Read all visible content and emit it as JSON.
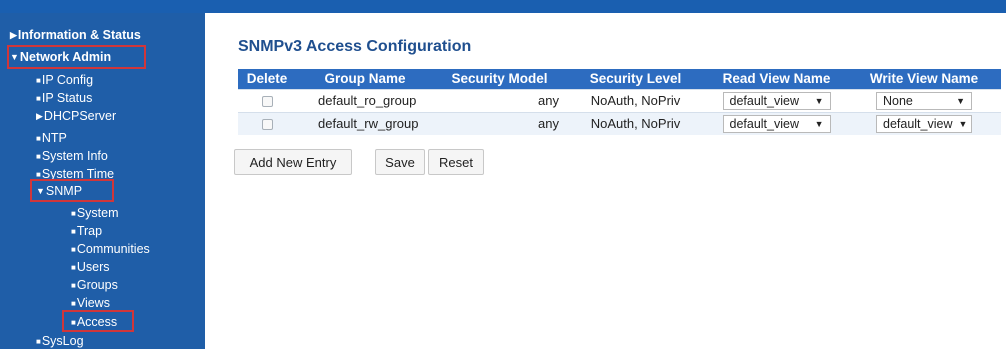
{
  "sidebar": {
    "items": [
      {
        "label": "Information & Status"
      },
      {
        "label": "Network Admin"
      },
      {
        "label": "IP Config"
      },
      {
        "label": "IP Status"
      },
      {
        "label": "DHCPServer"
      },
      {
        "label": "NTP"
      },
      {
        "label": "System Info"
      },
      {
        "label": "System Time"
      },
      {
        "label": "SNMP"
      },
      {
        "label": "System"
      },
      {
        "label": "Trap"
      },
      {
        "label": "Communities"
      },
      {
        "label": "Users"
      },
      {
        "label": "Groups"
      },
      {
        "label": "Views"
      },
      {
        "label": "Access"
      },
      {
        "label": "SysLog"
      }
    ]
  },
  "main": {
    "title": "SNMPv3 Access Configuration",
    "table": {
      "headers": [
        "Delete",
        "Group Name",
        "Security Model",
        "Security Level",
        "Read View Name",
        "Write View Name"
      ],
      "rows": [
        {
          "group": "default_ro_group",
          "model": "any",
          "level": "NoAuth, NoPriv",
          "read_view": "default_view",
          "write_view": "None"
        },
        {
          "group": "default_rw_group",
          "model": "any",
          "level": "NoAuth, NoPriv",
          "read_view": "default_view",
          "write_view": "default_view"
        }
      ]
    },
    "buttons": {
      "add": "Add New Entry",
      "save": "Save",
      "reset": "Reset"
    }
  },
  "colors": {
    "sidebar_bg": "#1f5ea8",
    "header_bg": "#2d6cc0",
    "title": "#1f4f8f",
    "highlight": "#d0363a"
  }
}
